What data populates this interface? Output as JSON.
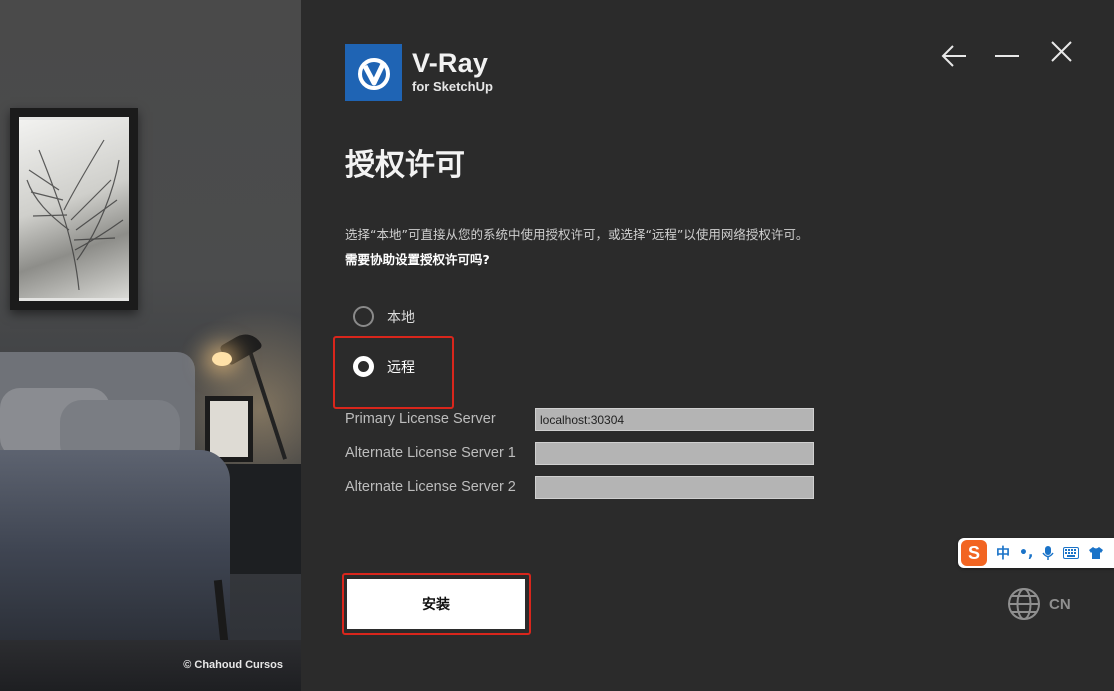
{
  "sidebar": {
    "credit": "© Chahoud Cursos"
  },
  "brand": {
    "title": "V-Ray",
    "subtitle": "for SketchUp",
    "logo_icon": "vray-logo-icon",
    "accent_color": "#1f64b4"
  },
  "window": {
    "back_icon": "arrow-left-icon",
    "minimize_icon": "minimize-icon",
    "close_icon": "close-icon"
  },
  "page": {
    "title": "授权许可",
    "description": "选择“本地”可直接从您的系统中使用授权许可，或选择“远程”以使用网络授权许可。",
    "help_link": "需要协助设置授权许可吗?"
  },
  "license_mode": {
    "options": [
      {
        "label": "本地",
        "checked": false
      },
      {
        "label": "远程",
        "checked": true
      }
    ]
  },
  "servers": {
    "primary_label": "Primary License Server",
    "primary_value": "localhost:30304",
    "alternate1_label": "Alternate License Server 1",
    "alternate1_value": "",
    "alternate2_label": "Alternate License Server 2",
    "alternate2_value": ""
  },
  "actions": {
    "install_label": "安装",
    "highlight_color": "#d9261c"
  },
  "language": {
    "icon": "globe-icon",
    "label": "CN"
  },
  "ime": {
    "logo": "S",
    "mode": "中",
    "punct": "•,",
    "icons": [
      "microphone-icon",
      "keyboard-icon",
      "skin-icon"
    ]
  }
}
